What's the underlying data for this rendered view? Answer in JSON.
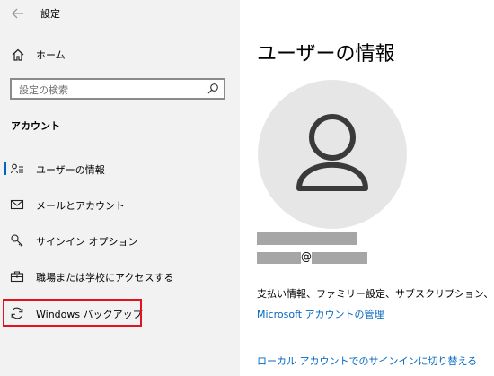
{
  "app": {
    "title": "設定"
  },
  "sidebar": {
    "home_label": "ホーム",
    "search": {
      "placeholder": "設定の検索"
    },
    "section_header": "アカウント",
    "items": [
      {
        "label": "ユーザーの情報",
        "icon": "user-info-icon",
        "selected": true
      },
      {
        "label": "メールとアカウント",
        "icon": "mail-icon",
        "selected": false
      },
      {
        "label": "サインイン オプション",
        "icon": "key-icon",
        "selected": false
      },
      {
        "label": "職場または学校にアクセスする",
        "icon": "briefcase-icon",
        "selected": false
      },
      {
        "label": "Windows バックアップ",
        "icon": "sync-icon",
        "selected": false
      }
    ]
  },
  "main": {
    "title": "ユーザーの情報",
    "email_at": "@",
    "info_text": "支払い情報、ファミリー設定、サブスクリプション、セキュリティ",
    "manage_link": "Microsoft アカウントの管理",
    "local_link": "ローカル アカウントでのサインインに切り替える"
  },
  "colors": {
    "sidebar_bg": "#f2f2f2",
    "accent": "#0067c0",
    "highlight_box": "#e2131f",
    "avatar_bg": "#e6e6e6",
    "redaction": "#a6a6a6"
  }
}
